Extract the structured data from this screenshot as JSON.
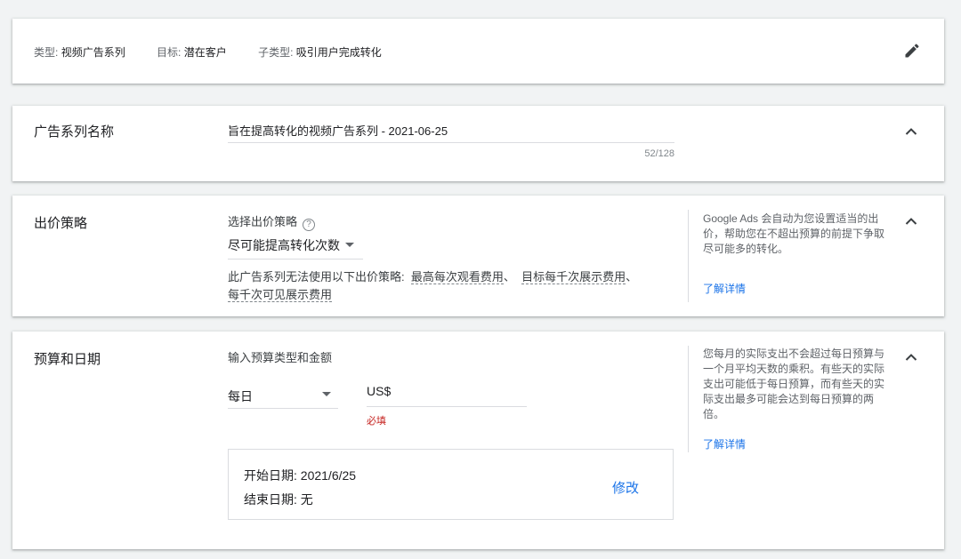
{
  "summary": {
    "type_label": "类型:",
    "type_value": "视频广告系列",
    "goal_label": "目标:",
    "goal_value": "潜在客户",
    "subtype_label": "子类型:",
    "subtype_value": "吸引用户完成转化",
    "edit_icon": "pencil-icon"
  },
  "campaign_name": {
    "title": "广告系列名称",
    "value": "旨在提高转化的视频广告系列 - 2021-06-25",
    "char_count": "52/128"
  },
  "bidding": {
    "title": "出价策略",
    "select_label": "选择出价策略",
    "help_icon": "?",
    "selected": "尽可能提高转化次数",
    "note_prefix": "此广告系列无法使用以下出价策略:",
    "unavailable": [
      "最高每次观看费用",
      "目标每千次展示费用",
      "每千次可见展示费用"
    ],
    "separator": "、",
    "side_text": "Google Ads 会自动为您设置适当的出价，帮助您在不超出预算的前提下争取尽可能多的转化。",
    "side_link": "了解详情"
  },
  "budget": {
    "title": "预算和日期",
    "label": "输入预算类型和金额",
    "period": "每日",
    "currency": "US$",
    "amount": "",
    "required": "必填",
    "start_date": "开始日期: 2021/6/25",
    "end_date": "结束日期: 无",
    "edit_label": "修改",
    "side_text": "您每月的实际支出不会超过每日预算与一个月平均天数的乘积。有些天的实际支出可能低于每日预算，而有些天的实际支出最多可能会达到每日预算的两倍。",
    "side_link": "了解详情"
  },
  "colors": {
    "link": "#1a73e8",
    "error": "#c5221f",
    "background": "#f1f3f4"
  }
}
